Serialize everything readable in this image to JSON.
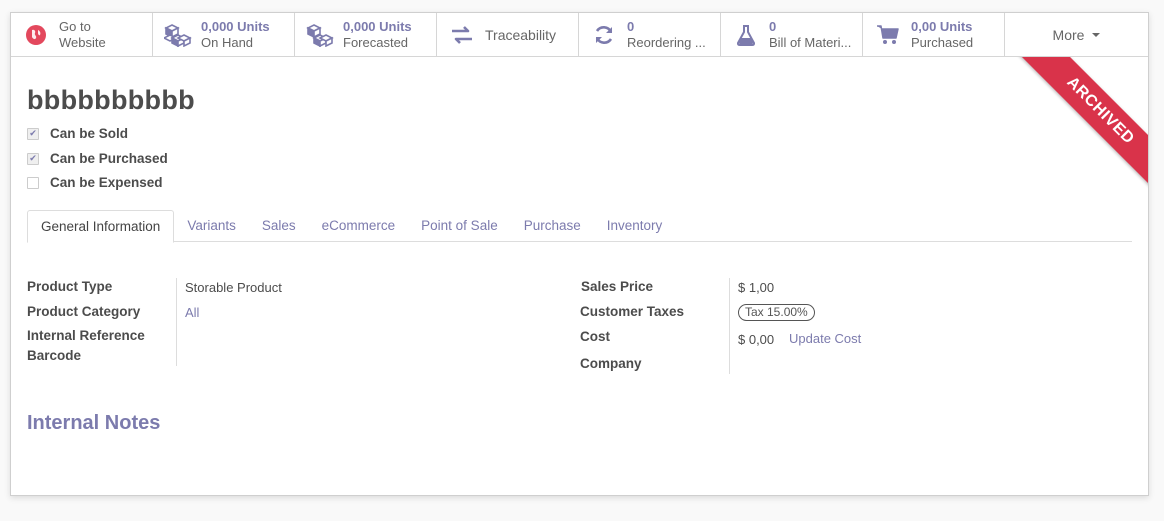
{
  "colors": {
    "accent": "#7c7bad",
    "ribbon": "#d9334a",
    "website_icon": "#e3485d"
  },
  "smart_buttons": [
    {
      "icon": "globe-icon",
      "value": "Go to",
      "label": "Website"
    },
    {
      "icon": "cubes-icon",
      "value": "0,000 Units",
      "label": "On Hand"
    },
    {
      "icon": "cubes-icon",
      "value": "0,000 Units",
      "label": "Forecasted"
    },
    {
      "icon": "exchange-icon",
      "label": "Traceability"
    },
    {
      "icon": "refresh-icon",
      "value": "0",
      "label": "Reordering ..."
    },
    {
      "icon": "flask-icon",
      "value": "0",
      "label": "Bill of Materi..."
    },
    {
      "icon": "cart-icon",
      "value": "0,00 Units",
      "label": "Purchased"
    }
  ],
  "more_label": "More",
  "ribbon": "ARCHIVED",
  "product_name": "bbbbbbbbbb",
  "options": [
    {
      "label": "Can be Sold",
      "checked": true
    },
    {
      "label": "Can be Purchased",
      "checked": true
    },
    {
      "label": "Can be Expensed",
      "checked": false
    }
  ],
  "tabs": [
    "General Information",
    "Variants",
    "Sales",
    "eCommerce",
    "Point of Sale",
    "Purchase",
    "Inventory"
  ],
  "left_fields": {
    "product_type_label": "Product Type",
    "product_type_value": "Storable Product",
    "product_category_label": "Product Category",
    "product_category_value": "All",
    "internal_reference_label": "Internal Reference",
    "barcode_label": "Barcode"
  },
  "right_fields": {
    "sales_price_label": "Sales Price",
    "sales_price_value": "$ 1,00",
    "customer_taxes_label": "Customer Taxes",
    "customer_taxes_value": "Tax 15.00%",
    "cost_label": "Cost",
    "cost_value": "$ 0,00",
    "update_cost_label": "Update Cost",
    "company_label": "Company"
  },
  "internal_notes_title": "Internal Notes"
}
